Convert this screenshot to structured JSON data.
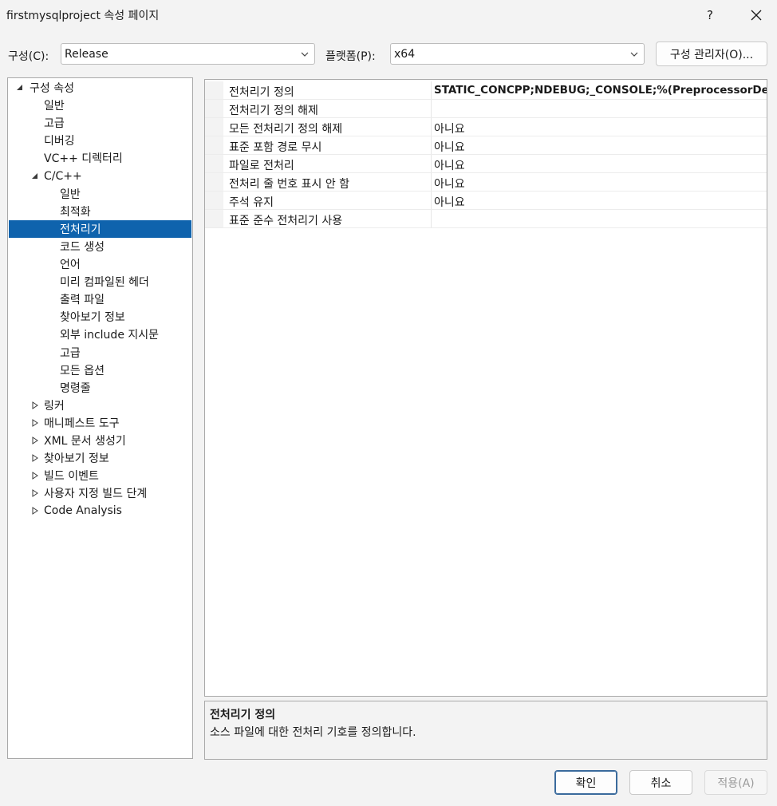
{
  "window": {
    "title": "firstmysqlproject 속성 페이지",
    "help_label": "?",
    "close_icon": "close-icon"
  },
  "toolbar": {
    "config_label": "구성(C):",
    "config_value": "Release",
    "platform_label": "플랫폼(P):",
    "platform_value": "x64",
    "config_manager_label": "구성 관리자(O)..."
  },
  "tree": {
    "items": [
      {
        "label": "구성 속성",
        "level": 0,
        "state": "expanded"
      },
      {
        "label": "일반",
        "level": 1,
        "state": "leaf"
      },
      {
        "label": "고급",
        "level": 1,
        "state": "leaf"
      },
      {
        "label": "디버깅",
        "level": 1,
        "state": "leaf"
      },
      {
        "label": "VC++ 디렉터리",
        "level": 1,
        "state": "leaf"
      },
      {
        "label": "C/C++",
        "level": 1,
        "state": "expanded"
      },
      {
        "label": "일반",
        "level": 2,
        "state": "leaf"
      },
      {
        "label": "최적화",
        "level": 2,
        "state": "leaf"
      },
      {
        "label": "전처리기",
        "level": 2,
        "state": "leaf",
        "selected": true
      },
      {
        "label": "코드 생성",
        "level": 2,
        "state": "leaf"
      },
      {
        "label": "언어",
        "level": 2,
        "state": "leaf"
      },
      {
        "label": "미리 컴파일된 헤더",
        "level": 2,
        "state": "leaf"
      },
      {
        "label": "출력 파일",
        "level": 2,
        "state": "leaf"
      },
      {
        "label": "찾아보기 정보",
        "level": 2,
        "state": "leaf"
      },
      {
        "label": "외부 include 지시문",
        "level": 2,
        "state": "leaf"
      },
      {
        "label": "고급",
        "level": 2,
        "state": "leaf"
      },
      {
        "label": "모든 옵션",
        "level": 2,
        "state": "leaf"
      },
      {
        "label": "명령줄",
        "level": 2,
        "state": "leaf"
      },
      {
        "label": "링커",
        "level": 1,
        "state": "collapsed"
      },
      {
        "label": "매니페스트 도구",
        "level": 1,
        "state": "collapsed"
      },
      {
        "label": "XML 문서 생성기",
        "level": 1,
        "state": "collapsed"
      },
      {
        "label": "찾아보기 정보",
        "level": 1,
        "state": "collapsed"
      },
      {
        "label": "빌드 이벤트",
        "level": 1,
        "state": "collapsed"
      },
      {
        "label": "사용자 지정 빌드 단계",
        "level": 1,
        "state": "collapsed"
      },
      {
        "label": "Code Analysis",
        "level": 1,
        "state": "collapsed"
      }
    ]
  },
  "properties": {
    "rows": [
      {
        "name": "전처리기 정의",
        "value": "STATIC_CONCPP;NDEBUG;_CONSOLE;%(PreprocessorDefin",
        "bold": true
      },
      {
        "name": "전처리기 정의 해제",
        "value": ""
      },
      {
        "name": "모든 전처리기 정의 해제",
        "value": "아니요"
      },
      {
        "name": "표준 포함 경로 무시",
        "value": "아니요"
      },
      {
        "name": "파일로 전처리",
        "value": "아니요"
      },
      {
        "name": "전처리 줄 번호 표시 안 함",
        "value": "아니요"
      },
      {
        "name": "주석 유지",
        "value": "아니요"
      },
      {
        "name": "표준 준수 전처리기 사용",
        "value": ""
      }
    ]
  },
  "description": {
    "title": "전처리기 정의",
    "text": "소스 파일에 대한 전처리 기호를 정의합니다."
  },
  "footer": {
    "ok_label": "확인",
    "cancel_label": "취소",
    "apply_label": "적용(A)"
  },
  "colors": {
    "selection": "#0f63ad",
    "background": "#f3f3f3"
  }
}
